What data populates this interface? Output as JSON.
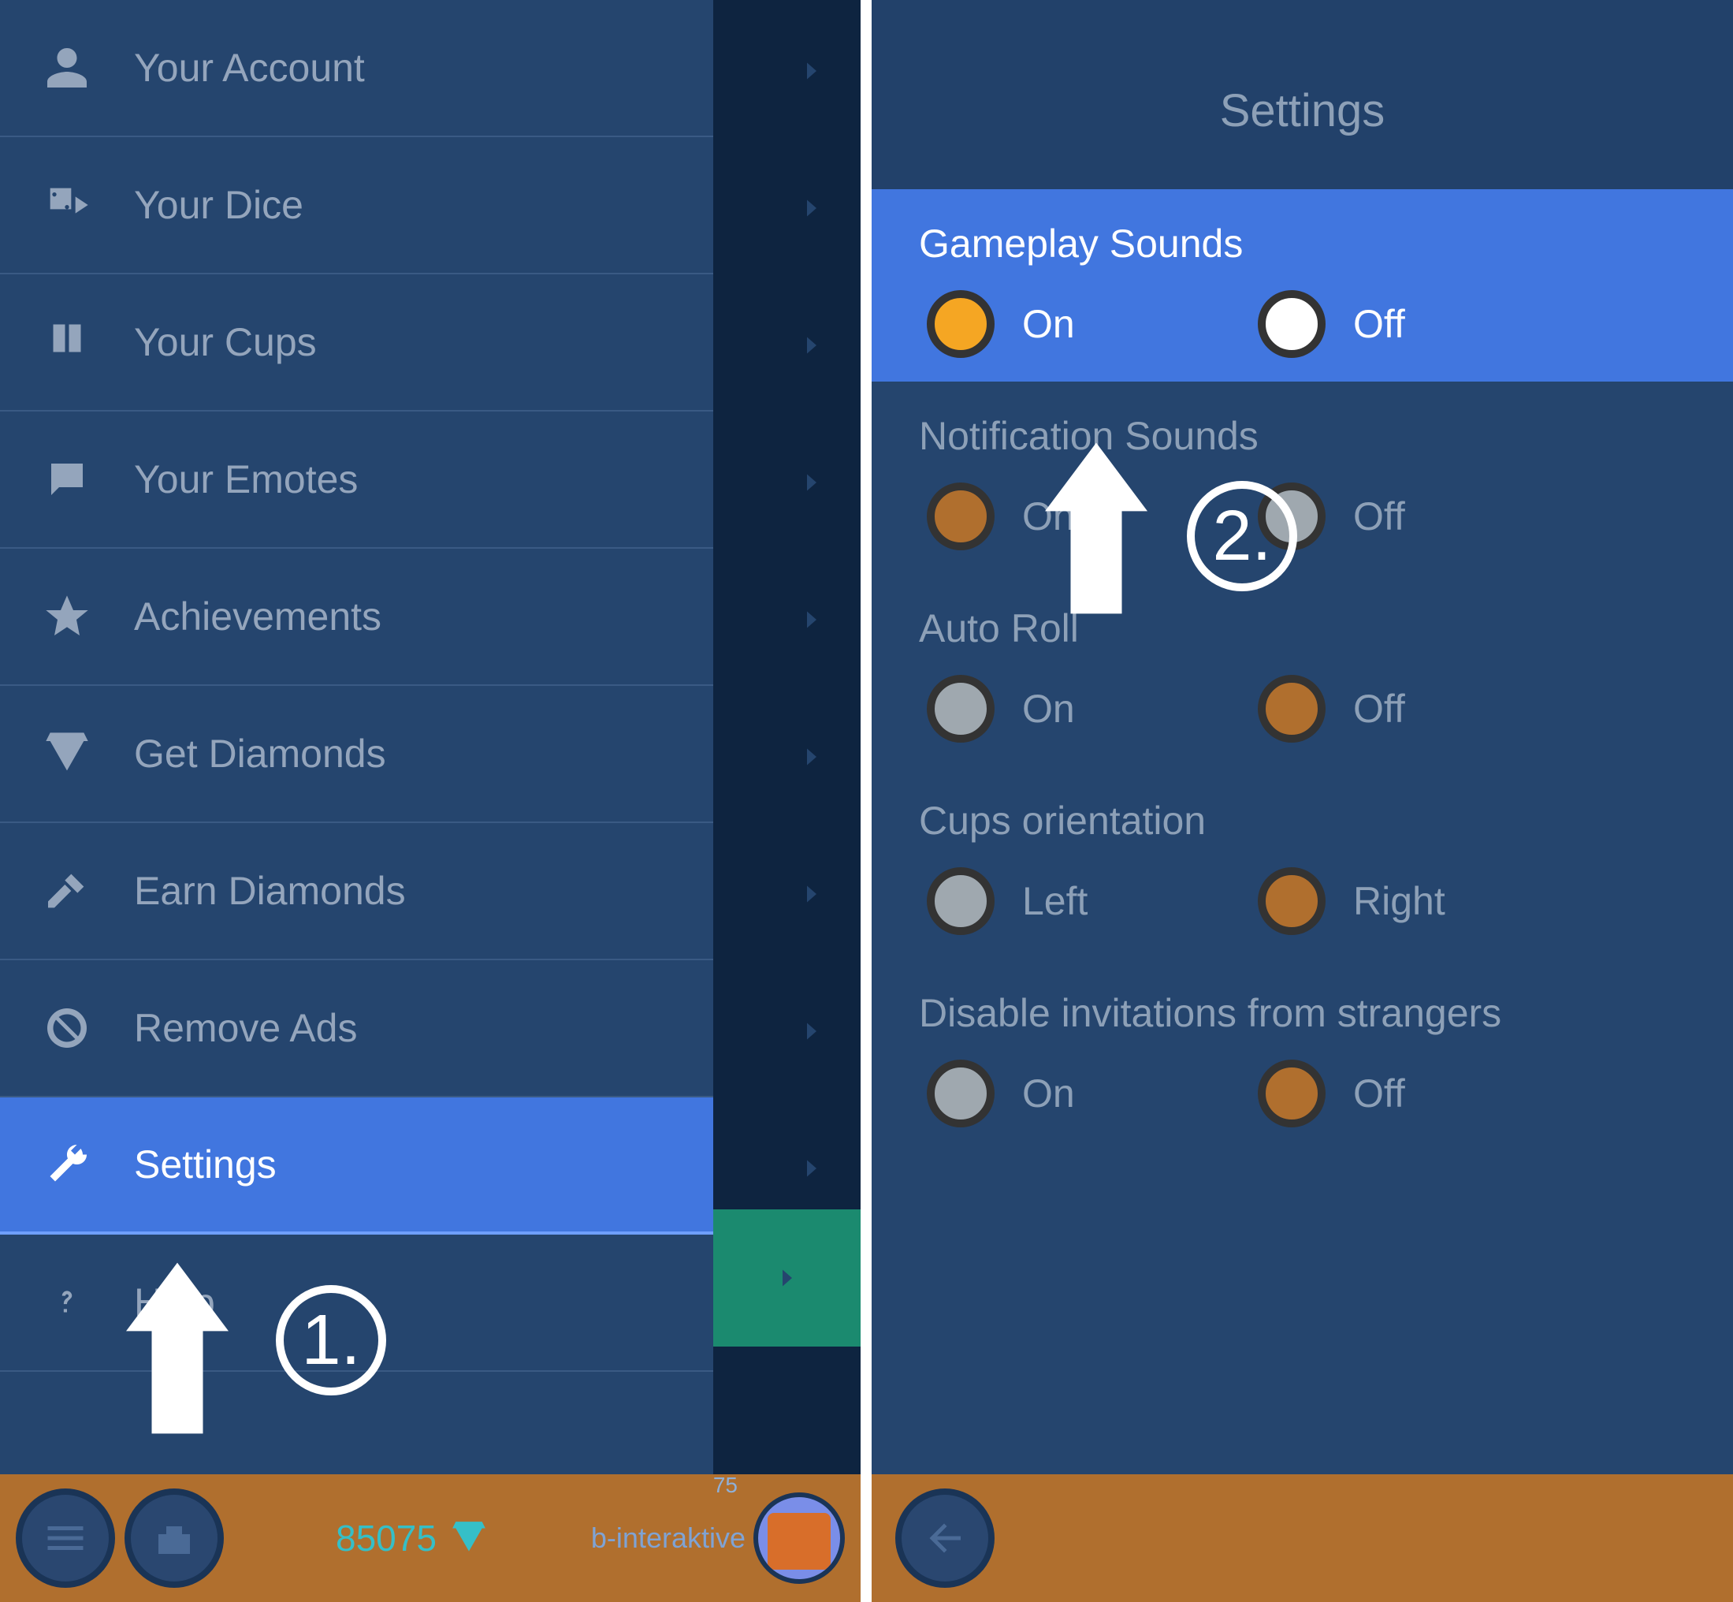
{
  "left": {
    "menu": [
      {
        "label": "Your Account",
        "icon": "person"
      },
      {
        "label": "Your Dice",
        "icon": "dice"
      },
      {
        "label": "Your Cups",
        "icon": "cups"
      },
      {
        "label": "Your Emotes",
        "icon": "emotes"
      },
      {
        "label": "Achievements",
        "icon": "star"
      },
      {
        "label": "Get Diamonds",
        "icon": "diamond"
      },
      {
        "label": "Earn Diamonds",
        "icon": "hammer"
      },
      {
        "label": "Remove Ads",
        "icon": "ban"
      },
      {
        "label": "Settings",
        "icon": "wrench",
        "active": true
      },
      {
        "label": "Help",
        "icon": "question"
      }
    ],
    "bottom": {
      "diamonds": "85075",
      "username": "b-interaktive",
      "level": "75"
    },
    "annotation": "1."
  },
  "right": {
    "header": "Settings",
    "groups": [
      {
        "title": "Gameplay Sounds",
        "highlight": true,
        "opt_on": "On",
        "opt_off": "Off",
        "sel": "on",
        "style": "yellow-white"
      },
      {
        "title": "Notification Sounds",
        "opt_on": "On",
        "opt_off": "Off",
        "sel": "on",
        "style": "brown-grey"
      },
      {
        "title": "Auto Roll",
        "opt_on": "On",
        "opt_off": "Off",
        "sel": "off",
        "style": "grey-brown"
      },
      {
        "title": "Cups orientation",
        "opt_on": "Left",
        "opt_off": "Right",
        "sel": "off",
        "style": "grey-brown"
      },
      {
        "title": "Disable invitations from strangers",
        "opt_on": "On",
        "opt_off": "Off",
        "sel": "off",
        "style": "grey-brown"
      }
    ],
    "annotation": "2."
  }
}
